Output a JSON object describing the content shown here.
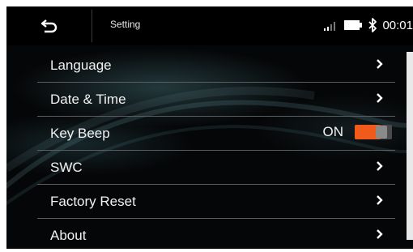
{
  "header": {
    "title": "Setting",
    "back_icon": "back-arrow-icon",
    "time": "00:01"
  },
  "status_icons": [
    "signal-icon",
    "battery-icon",
    "bluetooth-icon"
  ],
  "menu": {
    "items": [
      {
        "label": "Language",
        "control": "chevron-right-icon"
      },
      {
        "label": "Date & Time",
        "control": "chevron-right-icon"
      },
      {
        "label": "Key Beep",
        "control": "toggle",
        "value_text": "ON",
        "toggle_on": true
      },
      {
        "label": "SWC",
        "control": "chevron-right-icon"
      },
      {
        "label": "Factory Reset",
        "control": "chevron-right-icon"
      },
      {
        "label": "About",
        "control": "chevron-right-icon"
      }
    ]
  },
  "colors": {
    "background": "#050607",
    "accent_toggle": "#f05a1a",
    "text": "#f2f2f2",
    "divider": "#5a5e63"
  }
}
